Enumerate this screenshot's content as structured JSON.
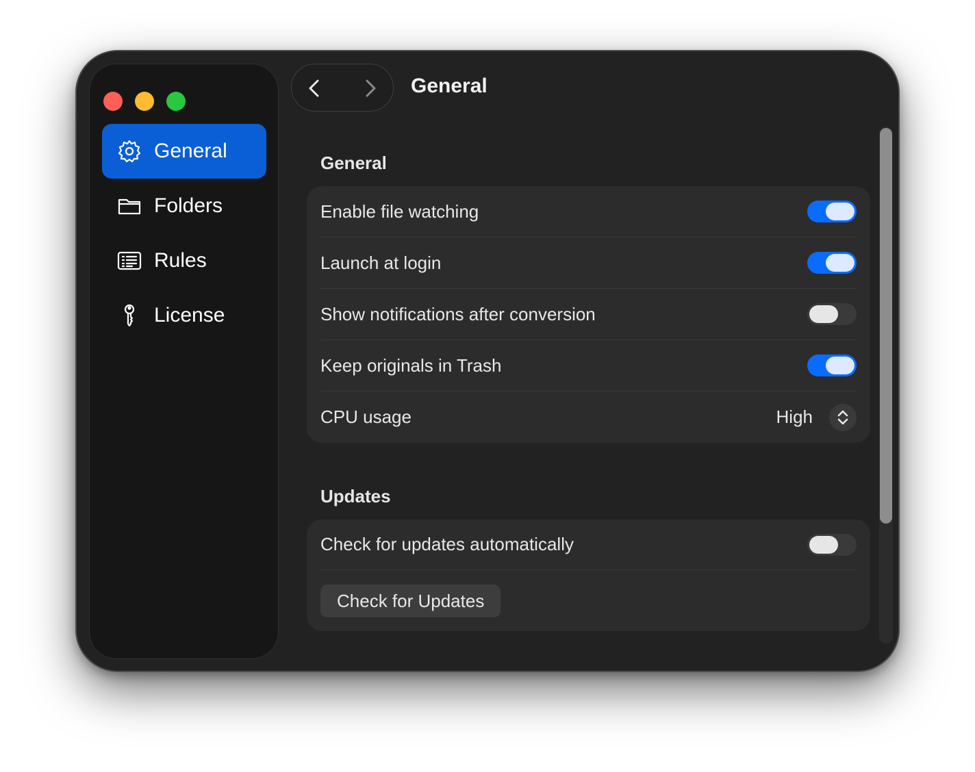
{
  "window": {
    "title": "General"
  },
  "sidebar": {
    "items": [
      {
        "label": "General",
        "icon": "gear-icon",
        "active": true
      },
      {
        "label": "Folders",
        "icon": "folder-icon",
        "active": false
      },
      {
        "label": "Rules",
        "icon": "list-icon",
        "active": false
      },
      {
        "label": "License",
        "icon": "key-icon",
        "active": false
      }
    ]
  },
  "sections": {
    "general": {
      "title": "General",
      "rows": [
        {
          "label": "Enable file watching",
          "state": "on"
        },
        {
          "label": "Launch at login",
          "state": "on"
        },
        {
          "label": "Show notifications after conversion",
          "state": "off"
        },
        {
          "label": "Keep originals in Trash",
          "state": "on"
        }
      ],
      "cpu": {
        "label": "CPU usage",
        "value": "High"
      }
    },
    "updates": {
      "title": "Updates",
      "auto": {
        "label": "Check for updates automatically",
        "state": "off"
      },
      "button_label": "Check for Updates"
    }
  },
  "colors": {
    "accent": "#0a5fd6",
    "toggle_on": "#0a6cff",
    "traffic_red": "#ff5f57",
    "traffic_yellow": "#febc2e",
    "traffic_green": "#28c840"
  }
}
